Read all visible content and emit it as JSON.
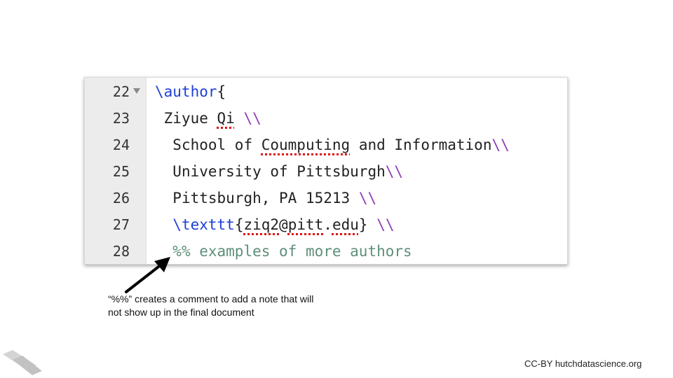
{
  "editor": {
    "lines": [
      {
        "num": "22",
        "folded": true
      },
      {
        "num": "23"
      },
      {
        "num": "24"
      },
      {
        "num": "25"
      },
      {
        "num": "26"
      },
      {
        "num": "27"
      },
      {
        "num": "28"
      }
    ],
    "code": {
      "l22": {
        "command": "\\author",
        "brace": "{"
      },
      "l23": {
        "indent": " ",
        "word1": "Ziyue",
        "space": " ",
        "word2": "Qi",
        "tail": " ",
        "linebreak": "\\\\"
      },
      "l24": {
        "indent": "  ",
        "pre": "School of ",
        "misspelled": "Coumputing",
        "post": " and Information",
        "linebreak": "\\\\"
      },
      "l25": {
        "indent": "  ",
        "text": "University of Pittsburgh",
        "linebreak": "\\\\"
      },
      "l26": {
        "indent": "  ",
        "text": "Pittsburgh, PA 15213 ",
        "linebreak": "\\\\"
      },
      "l27": {
        "indent": "  ",
        "command": "\\texttt",
        "open": "{",
        "e1": "ziq2",
        "at": "@",
        "e2": "pitt",
        "dot": ".",
        "e3": "edu",
        "close": "}",
        "space": " ",
        "linebreak": "\\\\"
      },
      "l28": {
        "indent": "  ",
        "comment": "%% examples of more authors"
      }
    }
  },
  "caption": "“%%” creates a comment to add a note that will not show up in the final document",
  "footer": "CC-BY hutchdatascience.org",
  "colors": {
    "command": "#1d3fd8",
    "linebreak": "#8e3db8",
    "comment": "#5e8f7a",
    "spellcheck": "#e01010",
    "gutter": "#ececec"
  },
  "icons": {
    "fold": "fold-triangle-icon",
    "arrow": "annotation-arrow-icon",
    "logo": "hutch-logo-icon"
  }
}
